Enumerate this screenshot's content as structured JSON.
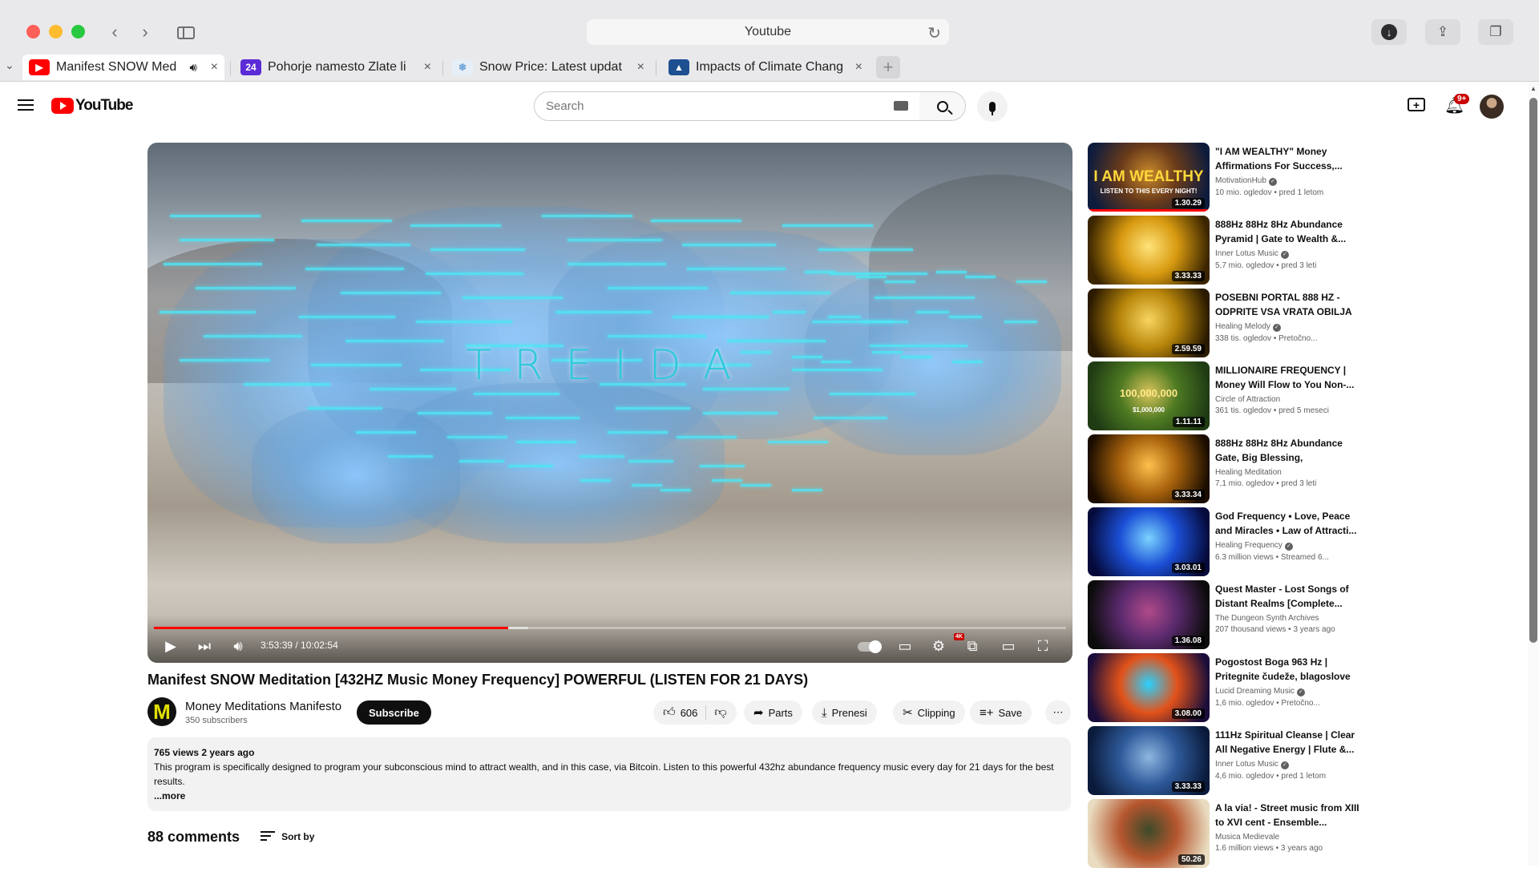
{
  "browser": {
    "address": "Youtube",
    "tabs": [
      {
        "title": "Manifest SNOW Med",
        "favicon": "youtube-icon",
        "playing": true
      },
      {
        "title": "Pohorje namesto Zlate li",
        "favicon": "24ur-icon",
        "favicon_text": "24"
      },
      {
        "title": "Snow Price: Latest updat",
        "favicon": "snow-icon"
      },
      {
        "title": "Impacts of Climate Chang",
        "favicon": "climate-icon"
      }
    ]
  },
  "youtube": {
    "logo_text": "YouTube",
    "search_placeholder": "Search",
    "notification_badge": "9+"
  },
  "player": {
    "overlay_title": "TREIDA",
    "time": "3:53:39 / 10:02:54",
    "progress_fraction": 0.388,
    "buffer_fraction": 0.41,
    "hd_badge": "4K"
  },
  "video": {
    "title": "Manifest SNOW Meditation [432HZ Music Money Frequency] POWERFUL (LISTEN FOR 21 DAYS)",
    "channel": "Money Meditations Manifesto",
    "channel_initial": "M",
    "subscribers": "350 subscribers",
    "subscribe_label": "Subscribe",
    "likes": "606",
    "actions": {
      "parts": "Parts",
      "download": "Prenesi",
      "clipping": "Clipping",
      "save": "Save"
    },
    "description_meta": "765 views 2 years ago",
    "description": "This program is specifically designed to program your subconscious mind to attract wealth, and in this case, via Bitcoin. Listen to this powerful 432hz abundance frequency music every day for 21 days for the best results.",
    "more_label": "...more",
    "comments_count": "88 comments",
    "sort_label": "Sort by"
  },
  "related": [
    {
      "title": "\"I AM WEALTHY\" Money Affirmations For Success,...",
      "channel": "MotivationHub",
      "verified": true,
      "meta": "10 mio. ogledov • pred 1 letom",
      "duration": "1.30.29",
      "thumb_text": "I AM WEALTHY",
      "thumb_sub": "LISTEN TO THIS EVERY NIGHT!",
      "colors": [
        "#0d1b3d",
        "#6a3b1a",
        "#c98a2c"
      ]
    },
    {
      "title": "888Hz 88Hz 8Hz Abundance Pyramid | Gate to Wealth &...",
      "channel": "Inner Lotus Music",
      "verified": true,
      "meta": "5,7 mio. ogledov • pred 3 leti",
      "duration": "3.33.33",
      "colors": [
        "#3a2500",
        "#d89a10",
        "#ffe37a"
      ]
    },
    {
      "title": "POSEBNI PORTAL 888 HZ - ODPRITE VSA VRATA OBILJA I...",
      "channel": "Healing Melody",
      "verified": true,
      "meta": "338 tis. ogledov • Pretočno...",
      "duration": "2.59.59",
      "colors": [
        "#2a1a00",
        "#b8860b",
        "#f7d560"
      ]
    },
    {
      "title": "MILLIONAIRE FREQUENCY | Money Will Flow to You Non-...",
      "channel": "Circle of Attraction",
      "verified": false,
      "meta": "361 tis. ogledov • pred 5 meseci",
      "duration": "1.11.11",
      "thumb_text": "100,000,000",
      "thumb_sub": "$1,000,000",
      "colors": [
        "#1e3b14",
        "#4e7a22",
        "#d8c35a"
      ]
    },
    {
      "title": "888Hz 88Hz 8Hz Abundance Gate, Big Blessing, Transform...",
      "channel": "Healing Meditation",
      "verified": false,
      "meta": "7,1 mio. ogledov • pred 3 leti",
      "duration": "3.33.34",
      "colors": [
        "#1a0d00",
        "#a8620c",
        "#ffc04d"
      ]
    },
    {
      "title": "God Frequency • Love, Peace and Miracles • Law of Attracti...",
      "channel": "Healing Frequency",
      "verified": true,
      "meta": "6.3 million views • Streamed 6...",
      "duration": "3.03.01",
      "colors": [
        "#050a3a",
        "#1b4fd6",
        "#7ad3ff"
      ]
    },
    {
      "title": "Quest Master - Lost Songs of Distant Realms [Complete...",
      "channel": "The Dungeon Synth Archives",
      "verified": false,
      "meta": "207 thousand views • 3 years ago",
      "duration": "1.36.08",
      "colors": [
        "#0b0b0b",
        "#5b2a6e",
        "#b04a8a"
      ]
    },
    {
      "title": "Pogostost Boga 963 Hz | Pritegnite čudeže, blagoslove i...",
      "channel": "Lucid Dreaming Music",
      "verified": true,
      "meta": "1,6 mio. ogledov • Pretočno...",
      "duration": "3.08.00",
      "colors": [
        "#1a0d3a",
        "#e2521a",
        "#2ad1ff"
      ]
    },
    {
      "title": "111Hz Spiritual Cleanse | Clear All Negative Energy | Flute &...",
      "channel": "Inner Lotus Music",
      "verified": true,
      "meta": "4,6 mio. ogledov • pred 1 letom",
      "duration": "3.33.33",
      "colors": [
        "#0a1a3a",
        "#2e5a9a",
        "#8fb6e0"
      ]
    },
    {
      "title": "A la via! - Street music from XIII to XVI cent - Ensemble...",
      "channel": "Musica Medievale",
      "verified": false,
      "meta": "1.6 million views • 3 years ago",
      "duration": "50.26",
      "colors": [
        "#e9dcc0",
        "#b5562e",
        "#3c4a2a"
      ]
    }
  ]
}
